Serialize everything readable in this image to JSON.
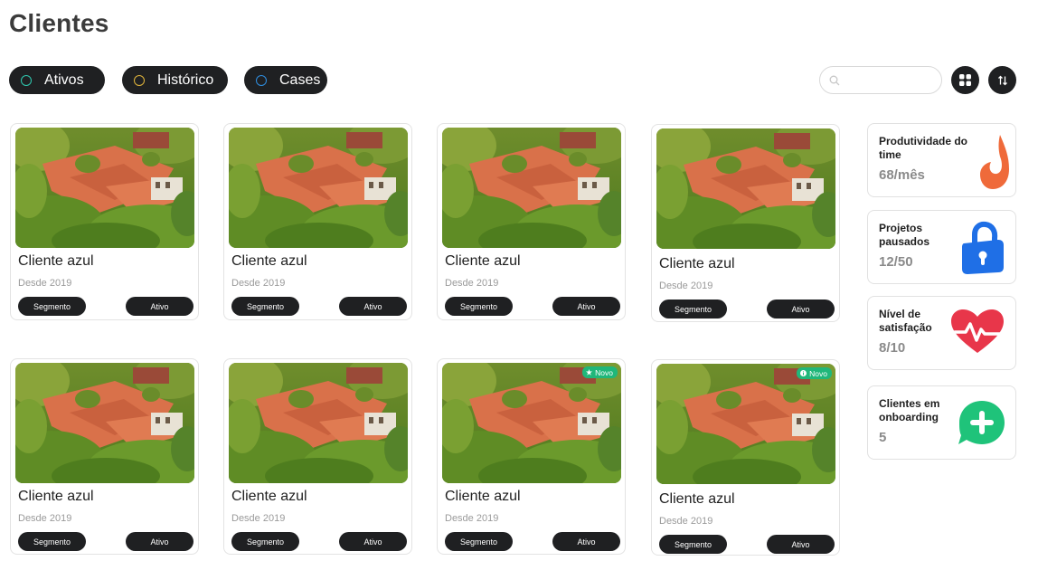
{
  "page": {
    "title": "Clientes"
  },
  "filters": [
    {
      "label": "Ativos",
      "ring_color": "#2fc9b0"
    },
    {
      "label": "Histórico",
      "ring_color": "#e0b43c"
    },
    {
      "label": "Cases",
      "ring_color": "#2f8ee0"
    }
  ],
  "search": {
    "placeholder": "",
    "value": ""
  },
  "toolbar": {
    "grid_view_icon": "grid-icon",
    "sort_icon": "sort-arrows-icon"
  },
  "clients": [
    {
      "name": "Cliente azul",
      "since": "Desde 2019",
      "segment": "Segmento",
      "status": "Ativo",
      "badge": ""
    },
    {
      "name": "Cliente azul",
      "since": "Desde 2019",
      "segment": "Segmento",
      "status": "Ativo",
      "badge": ""
    },
    {
      "name": "Cliente azul",
      "since": "Desde 2019",
      "segment": "Segmento",
      "status": "Ativo",
      "badge": ""
    },
    {
      "name": "Cliente azul",
      "since": "Desde 2019",
      "segment": "Segmento",
      "status": "Ativo",
      "badge": ""
    },
    {
      "name": "Cliente azul",
      "since": "Desde 2019",
      "segment": "Segmento",
      "status": "Ativo",
      "badge": ""
    },
    {
      "name": "Cliente azul",
      "since": "Desde 2019",
      "segment": "Segmento",
      "status": "Ativo",
      "badge": ""
    },
    {
      "name": "Cliente azul",
      "since": "Desde 2019",
      "segment": "Segmento",
      "status": "Ativo",
      "badge": "Novo",
      "badge_icon": "star-icon"
    },
    {
      "name": "Cliente azul",
      "since": "Desde 2019",
      "segment": "Segmento",
      "status": "Ativo",
      "badge": "Novo",
      "badge_icon": "info-icon"
    }
  ],
  "stats": [
    {
      "label": "Produtividade do time",
      "value": "68/mês",
      "icon": "flame-icon",
      "color": "#ef6a3a"
    },
    {
      "label": "Projetos pausados",
      "value": "12/50",
      "icon": "lock-icon",
      "color": "#1f6fe6"
    },
    {
      "label": "Nível de satisfação",
      "value": "8/10",
      "icon": "heart-pulse-icon",
      "color": "#e8364a"
    },
    {
      "label": "Clientes em onboarding",
      "value": "5",
      "icon": "chat-plus-icon",
      "color": "#1fc37a"
    }
  ]
}
